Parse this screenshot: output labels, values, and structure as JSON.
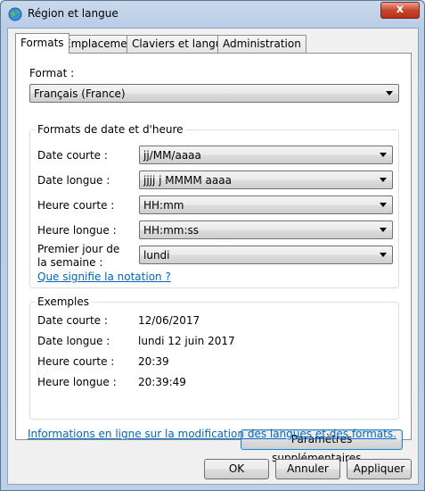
{
  "window": {
    "title": "Région et langue",
    "close_label": "x"
  },
  "tabs": [
    {
      "label": "Formats",
      "active": true
    },
    {
      "label": "Emplacement"
    },
    {
      "label": "Claviers et langues"
    },
    {
      "label": "Administration"
    }
  ],
  "format": {
    "label": "Format :",
    "value": "Français (France)"
  },
  "date_time_group": {
    "title": "Formats de date et d'heure",
    "rows": [
      {
        "label": "Date courte :",
        "value": "jj/MM/aaaa"
      },
      {
        "label": "Date longue :",
        "value": "jjjj j MMMM aaaa"
      },
      {
        "label": "Heure courte :",
        "value": "HH:mm"
      },
      {
        "label": "Heure longue :",
        "value": "HH:mm:ss"
      }
    ],
    "first_day_label_line1": "Premier jour de",
    "first_day_label_line2": "la semaine :",
    "first_day_value": "lundi",
    "notation_link": "Que signifie la notation ?"
  },
  "examples_group": {
    "title": "Exemples",
    "rows": [
      {
        "label": "Date courte :",
        "value": "12/06/2017"
      },
      {
        "label": "Date longue :",
        "value": "lundi 12 juin 2017"
      },
      {
        "label": "Heure courte :",
        "value": "20:39"
      },
      {
        "label": "Heure longue :",
        "value": "20:39:49"
      }
    ]
  },
  "additional_settings_button": "Paramètres supplémentaires...",
  "online_info_link": "Informations en ligne sur la modification des langues et des formats.",
  "footer": {
    "ok": "OK",
    "cancel": "Annuler",
    "apply": "Appliquer"
  }
}
